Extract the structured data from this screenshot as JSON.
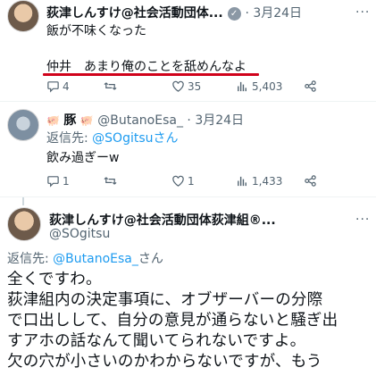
{
  "tweet1": {
    "name": "荻津しんすけ@社会活動団体...",
    "date": "· 3月24日",
    "line1": "飯が不味くなった",
    "line2": "仲井　あまり俺のことを舐めんなよ",
    "replies": "4",
    "retweets": "",
    "likes": "35",
    "views": "5,403"
  },
  "tweet2": {
    "name_prefix": "🐖",
    "name": "豚",
    "name_suffix": "🐖",
    "handle": "@ButanoEsa_",
    "date": "· 3月24日",
    "reply_to_label": "返信先: ",
    "reply_to_handle": "@SOgitsuさん",
    "text": "飲み過ぎーw",
    "replies": "1",
    "retweets": "",
    "likes": "1",
    "views": "1,433"
  },
  "tweet3": {
    "name": "荻津しんすけ@社会活動団体荻津組®...",
    "handle": "@SOgitsu",
    "reply_to_label": "返信先: ",
    "reply_to_handle": "@ButanoEsa_",
    "reply_to_suffix": "さん",
    "lines": [
      "全くですわ。",
      "荻津組内の決定事項に、オブザーバーの分際",
      "で口出しして、自分の意見が通らないと騒ぎ出",
      "すアホの話なんて聞いてられないですよ。",
      "欠の穴が小さいのかわからないですが、もう"
    ]
  },
  "colors": {
    "underline": "#d0021b",
    "link": "#1d9bf0",
    "muted": "#536471"
  }
}
